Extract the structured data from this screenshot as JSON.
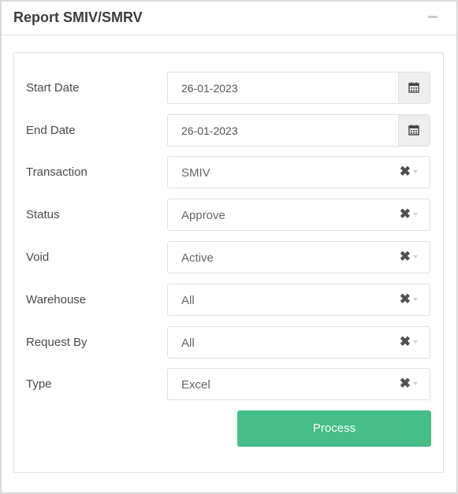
{
  "header": {
    "title": "Report SMIV/SMRV"
  },
  "form": {
    "start_date": {
      "label": "Start Date",
      "value": "26-01-2023"
    },
    "end_date": {
      "label": "End Date",
      "value": "26-01-2023"
    },
    "transaction": {
      "label": "Transaction",
      "value": "SMIV"
    },
    "status": {
      "label": "Status",
      "value": "Approve"
    },
    "void": {
      "label": "Void",
      "value": "Active"
    },
    "warehouse": {
      "label": "Warehouse",
      "value": "All"
    },
    "request_by": {
      "label": "Request By",
      "value": "All"
    },
    "type": {
      "label": "Type",
      "value": "Excel"
    },
    "clear_glyph": "✖",
    "process_label": "Process"
  },
  "colors": {
    "accent": "#45be87"
  },
  "icons": {
    "date_picker": "calendar-icon",
    "clear": "clear-icon",
    "dropdown": "caret-down-icon",
    "collapse": "minus-icon"
  }
}
